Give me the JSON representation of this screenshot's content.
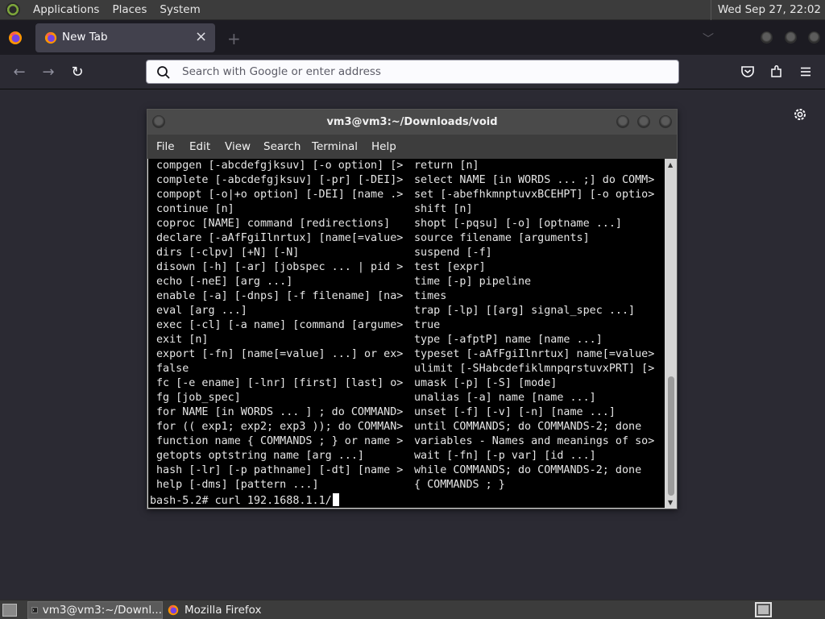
{
  "top_panel": {
    "menus": [
      "Applications",
      "Places",
      "System"
    ],
    "clock": "Wed Sep 27, 22:02"
  },
  "firefox": {
    "tab": {
      "title": "New Tab"
    },
    "urlbar": {
      "placeholder": "Search with Google or enter address",
      "value": ""
    }
  },
  "terminal": {
    "title": "vm3@vm3:~/Downloads/void",
    "menu": [
      "File",
      "Edit",
      "View",
      "Search",
      "Terminal",
      "Help"
    ],
    "left_col": [
      "compgen [-abcdefgjksuv] [-o option] [>",
      "complete [-abcdefgjksuv] [-pr] [-DEI]>",
      "compopt [-o|+o option] [-DEI] [name .>",
      "continue [n]",
      "coproc [NAME] command [redirections]",
      "declare [-aAfFgiIlnrtux] [name[=value>",
      "dirs [-clpv] [+N] [-N]",
      "disown [-h] [-ar] [jobspec ... | pid >",
      "echo [-neE] [arg ...]",
      "enable [-a] [-dnps] [-f filename] [na>",
      "eval [arg ...]",
      "exec [-cl] [-a name] [command [argume>",
      "exit [n]",
      "export [-fn] [name[=value] ...] or ex>",
      "false",
      "fc [-e ename] [-lnr] [first] [last] o>",
      "fg [job_spec]",
      "for NAME [in WORDS ... ] ; do COMMAND>",
      "for (( exp1; exp2; exp3 )); do COMMAN>",
      "function name { COMMANDS ; } or name >",
      "getopts optstring name [arg ...]",
      "hash [-lr] [-p pathname] [-dt] [name >",
      "help [-dms] [pattern ...]"
    ],
    "right_col": [
      "return [n]",
      "select NAME [in WORDS ... ;] do COMM>",
      "set [-abefhkmnptuvxBCEHPT] [-o optio>",
      "shift [n]",
      "shopt [-pqsu] [-o] [optname ...]",
      "source filename [arguments]",
      "suspend [-f]",
      "test [expr]",
      "time [-p] pipeline",
      "times",
      "trap [-lp] [[arg] signal_spec ...]",
      "true",
      "type [-afptP] name [name ...]",
      "typeset [-aAfFgiIlnrtux] name[=value>",
      "ulimit [-SHabcdefiklmnpqrstuvxPRT] [>",
      "umask [-p] [-S] [mode]",
      "unalias [-a] name [name ...]",
      "unset [-f] [-v] [-n] [name ...]",
      "until COMMANDS; do COMMANDS-2; done",
      "variables - Names and meanings of so>",
      "wait [-fn] [-p var] [id ...]",
      "while COMMANDS; do COMMANDS-2; done",
      "{ COMMANDS ; }"
    ],
    "prompt": "bash-5.2# curl 192.1688.1.1/"
  },
  "taskbar": {
    "items": [
      "vm3@vm3:~/Downl...",
      "Mozilla Firefox"
    ]
  },
  "colors": {
    "firefox_bg": "#2b2a33",
    "tabbar_bg": "#1c1b22",
    "panel_bg": "#3c3c3c",
    "terminal_bg": "#000000"
  }
}
